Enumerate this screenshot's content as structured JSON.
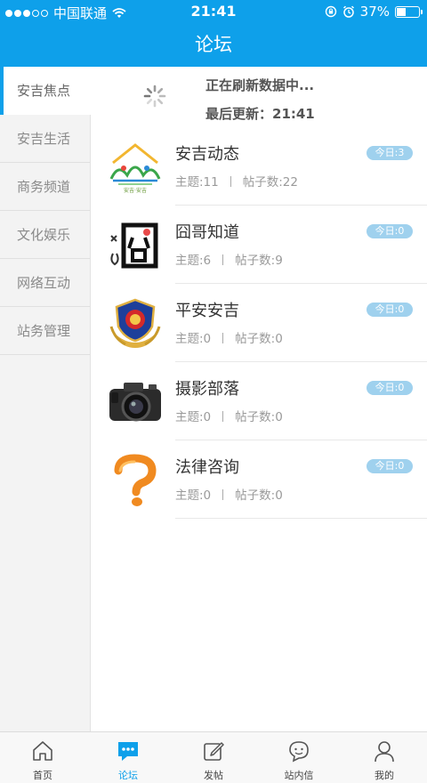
{
  "status_bar": {
    "carrier": "中国联通",
    "time": "21:41",
    "battery": "37%",
    "battery_level": 0.37
  },
  "header": {
    "title": "论坛"
  },
  "sidebar": {
    "items": [
      {
        "label": "安吉焦点",
        "active": true
      },
      {
        "label": "安吉生活",
        "active": false
      },
      {
        "label": "商务频道",
        "active": false
      },
      {
        "label": "文化娱乐",
        "active": false
      },
      {
        "label": "网络互动",
        "active": false
      },
      {
        "label": "站务管理",
        "active": false
      }
    ]
  },
  "refresh": {
    "status": "正在刷新数据中...",
    "last_updated": "最后更新：21:41"
  },
  "forums": [
    {
      "name": "安吉动态",
      "topics": "主题:11",
      "posts": "帖子数:22",
      "today": "今日:3",
      "icon": "anji-logo-icon"
    },
    {
      "name": "囧哥知道",
      "topics": "主题:6",
      "posts": "帖子数:9",
      "today": "今日:0",
      "icon": "jiong-icon"
    },
    {
      "name": "平安安吉",
      "topics": "主题:0",
      "posts": "帖子数:0",
      "today": "今日:0",
      "icon": "police-badge-icon"
    },
    {
      "name": "摄影部落",
      "topics": "主题:0",
      "posts": "帖子数:0",
      "today": "今日:0",
      "icon": "camera-icon"
    },
    {
      "name": "法律咨询",
      "topics": "主题:0",
      "posts": "帖子数:0",
      "today": "今日:0",
      "icon": "question-mark-icon"
    }
  ],
  "tabbar": {
    "items": [
      {
        "label": "首页",
        "icon": "home-icon",
        "active": false
      },
      {
        "label": "论坛",
        "icon": "forum-icon",
        "active": true
      },
      {
        "label": "发帖",
        "icon": "compose-icon",
        "active": false
      },
      {
        "label": "站内信",
        "icon": "message-icon",
        "active": false
      },
      {
        "label": "我的",
        "icon": "profile-icon",
        "active": false
      }
    ]
  },
  "colors": {
    "accent": "#0ea0ea",
    "badge": "#9fd1ee"
  }
}
